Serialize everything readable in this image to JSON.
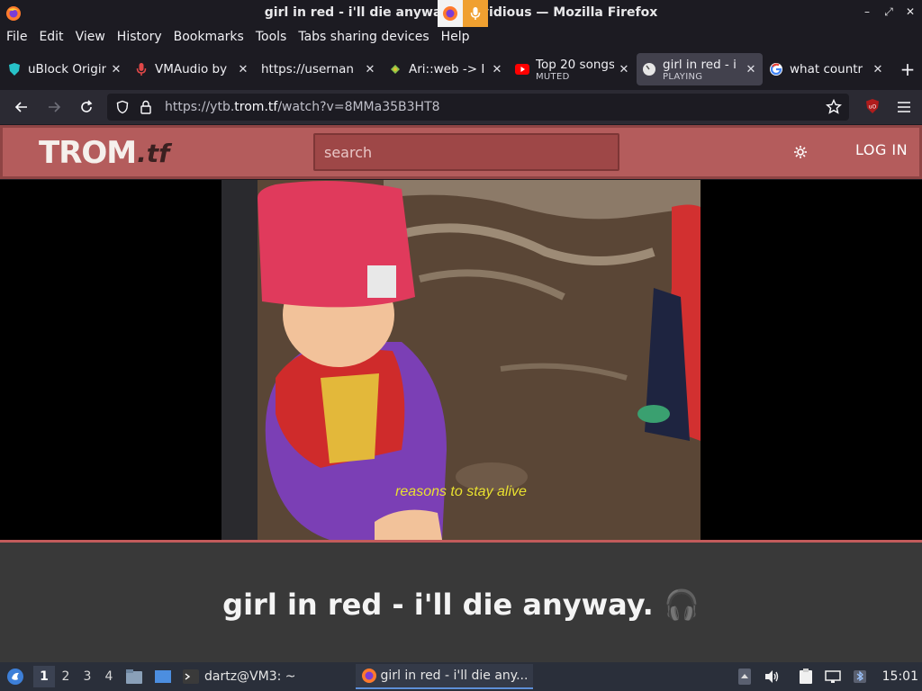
{
  "window": {
    "title": "girl in red - i'll die anyway. - Invidious — Mozilla Firefox"
  },
  "menubar": {
    "items": [
      "File",
      "Edit",
      "View",
      "History",
      "Bookmarks",
      "Tools",
      "Tabs sharing devices",
      "Help"
    ]
  },
  "tabs": [
    {
      "label": "uBlock Origin",
      "sub": "",
      "icon": "ublock-icon",
      "active": false
    },
    {
      "label": "VMAudio by",
      "sub": "",
      "icon": "microphone-icon",
      "active": false
    },
    {
      "label": "https://usernan",
      "sub": "",
      "icon": "",
      "active": false
    },
    {
      "label": "Ari::web -> I",
      "sub": "",
      "icon": "puzzle-icon",
      "active": false
    },
    {
      "label": "Top 20 songs",
      "sub": "MUTED",
      "icon": "youtube-icon",
      "active": false
    },
    {
      "label": "girl in red - i",
      "sub": "PLAYING",
      "icon": "invidious-icon",
      "active": true
    },
    {
      "label": "what countr",
      "sub": "",
      "icon": "google-icon",
      "active": false
    }
  ],
  "navbar": {
    "url_prefix": "https://ytb.",
    "url_domain": "trom.tf",
    "url_path": "/watch?v=8MMa35B3HT8"
  },
  "site": {
    "logo_main": "TROM",
    "logo_tf": ".tf",
    "search_placeholder": "search",
    "login_label": "LOG IN"
  },
  "video": {
    "caption": "reasons to stay alive",
    "title": "girl in red - i'll die anyway. 🎧"
  },
  "taskbar": {
    "workspaces": [
      "1",
      "2",
      "3",
      "4"
    ],
    "active_workspace": "1",
    "terminal_label": "dartz@VM3: ~",
    "firefox_label": "girl in red - i'll die any...",
    "clock": "15:01"
  },
  "colors": {
    "site_header": "#b45c5c",
    "accent": "#c25b5b",
    "caption": "#e8e030"
  }
}
